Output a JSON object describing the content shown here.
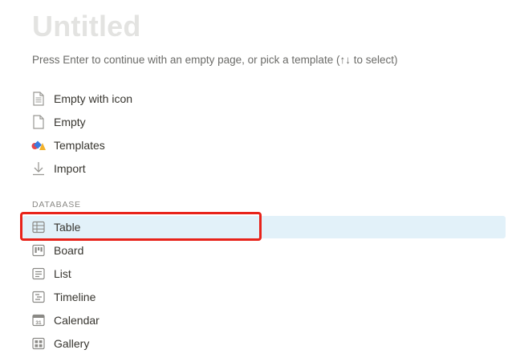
{
  "page": {
    "title": "Untitled",
    "hint": "Press Enter to continue with an empty page, or pick a template (↑↓ to select)"
  },
  "menu": {
    "items": [
      {
        "label": "Empty with icon",
        "icon": "page-lines-icon"
      },
      {
        "label": "Empty",
        "icon": "page-blank-icon"
      },
      {
        "label": "Templates",
        "icon": "shapes-icon"
      },
      {
        "label": "Import",
        "icon": "download-arrow-icon"
      }
    ]
  },
  "database": {
    "section_label": "DATABASE",
    "selected_index": 0,
    "items": [
      {
        "label": "Table",
        "icon": "table-icon"
      },
      {
        "label": "Board",
        "icon": "board-icon"
      },
      {
        "label": "List",
        "icon": "list-icon"
      },
      {
        "label": "Timeline",
        "icon": "timeline-icon"
      },
      {
        "label": "Calendar",
        "icon": "calendar-icon"
      },
      {
        "label": "Gallery",
        "icon": "gallery-icon"
      }
    ]
  },
  "colors": {
    "selected_bg": "#e2f1f9",
    "highlight_border": "#e8231a",
    "title": "#e3e3e1"
  }
}
